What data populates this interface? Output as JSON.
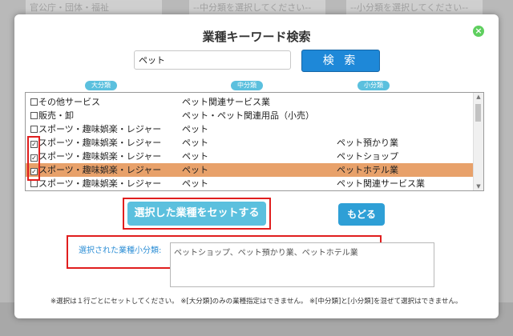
{
  "background": {
    "select1": "官公庁・団体・福祉",
    "select2": "--中分類を選択してください--",
    "select3": "--小分類を選択してください--"
  },
  "modal": {
    "title": "業種キーワード検索",
    "search": {
      "value": "ペット",
      "button_label": "検 索"
    },
    "columns": {
      "large": "大分類",
      "middle": "中分類",
      "small": "小分類"
    },
    "rows": [
      {
        "large": "その他サービス",
        "middle": "ペット関連サービス業",
        "small": "",
        "checked": false,
        "selected": false
      },
      {
        "large": "販売・卸",
        "middle": "ペット・ペット関連用品（小売）",
        "small": "",
        "checked": false,
        "selected": false
      },
      {
        "large": "スポーツ・趣味娯楽・レジャー",
        "middle": "ペット",
        "small": "",
        "checked": false,
        "selected": false
      },
      {
        "large": "スポーツ・趣味娯楽・レジャー",
        "middle": "ペット",
        "small": "ペット預かり業",
        "checked": true,
        "selected": false
      },
      {
        "large": "スポーツ・趣味娯楽・レジャー",
        "middle": "ペット",
        "small": "ペットショップ",
        "checked": true,
        "selected": false
      },
      {
        "large": "スポーツ・趣味娯楽・レジャー",
        "middle": "ペット",
        "small": "ペットホテル業",
        "checked": true,
        "selected": true
      },
      {
        "large": "スポーツ・趣味娯楽・レジャー",
        "middle": "ペット",
        "small": "ペット関連サービス業",
        "checked": false,
        "selected": false
      }
    ],
    "set_button_label": "選択した業種をセットする",
    "back_button_label": "もどる",
    "selected_label": "選択された業種小分類:",
    "selected_value": "ペットショップ、ペット預かり業、ペットホテル業",
    "footnote": "※選択は１行ごとにセットしてください。 ※[大分類]のみの業種指定はできません。 ※[中分類]と[小分類]を混ぜて選択はできません。",
    "colors": {
      "accent": "#1e88d8",
      "badge": "#5bc0de",
      "selected_row": "#e8a16a",
      "highlight": "#e01e1e"
    }
  }
}
